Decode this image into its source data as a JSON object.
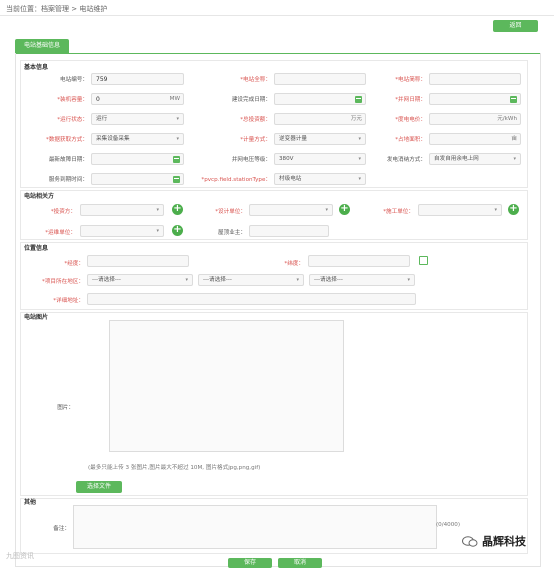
{
  "breadcrumb": "当前位置：档案管理 > 电站维护",
  "back_label": "返回",
  "tab_label": "电站基础信息",
  "basic": {
    "title": "基本信息",
    "station_no_label": "电站编号：",
    "station_no_value": "759",
    "full_name_label": "*电站全称：",
    "short_name_label": "*电站简称：",
    "capacity_label": "*装机容量：",
    "capacity_value": "0",
    "capacity_unit": "MW",
    "build_date_label": "建设完成日期：",
    "grid_date_label": "*并网日期：",
    "status_label": "*运行状态：",
    "status_value": "运行",
    "invest_label": "*总投资额：",
    "invest_unit": "万元",
    "price_label": "*度电电价：",
    "price_unit": "元/kWh",
    "acquire_label": "*数据获取方式：",
    "acquire_value": "采集设备采集",
    "meter_label": "*计量方式：",
    "meter_value": "逆变器计量",
    "area_label": "*占地面积：",
    "area_unit": "亩",
    "fault_date_label": "最新故障日期：",
    "voltage_label": "并网电压等级：",
    "voltage_value": "380V",
    "mode_label": "发电消纳方式：",
    "mode_value": "自发自用余电上网",
    "service_label": "服务到期时间：",
    "type_label": "*pvcp.field.stationType：",
    "type_value": "村级电站"
  },
  "related": {
    "title": "电站相关方",
    "investor_label": "*投资方：",
    "designer_label": "*设计单位：",
    "builder_label": "*施工单位：",
    "operator_label": "*运维单位：",
    "owner_label": "屋顶业主："
  },
  "location": {
    "title": "位置信息",
    "lng_label": "*经度：",
    "lat_label": "*纬度：",
    "region_label": "*项目所在地区：",
    "select_placeholder": "---请选择---",
    "address_label": "*详细地址："
  },
  "photo": {
    "title": "电站图片",
    "label": "图片：",
    "hint": "(最多只能上传 3 张图片,图片最大不超过 10M, 图片格式jpg,png,gif)",
    "pick_label": "选择文件"
  },
  "other": {
    "title": "其他",
    "remark_label": "备注：",
    "counter": "(0/4000)"
  },
  "save_label": "保存",
  "cancel_label": "取消",
  "watermark_left": "九图资讯",
  "watermark_right": "晶辉科技",
  "colors": {
    "accent": "#5cb85c",
    "required": "#d9534f"
  }
}
